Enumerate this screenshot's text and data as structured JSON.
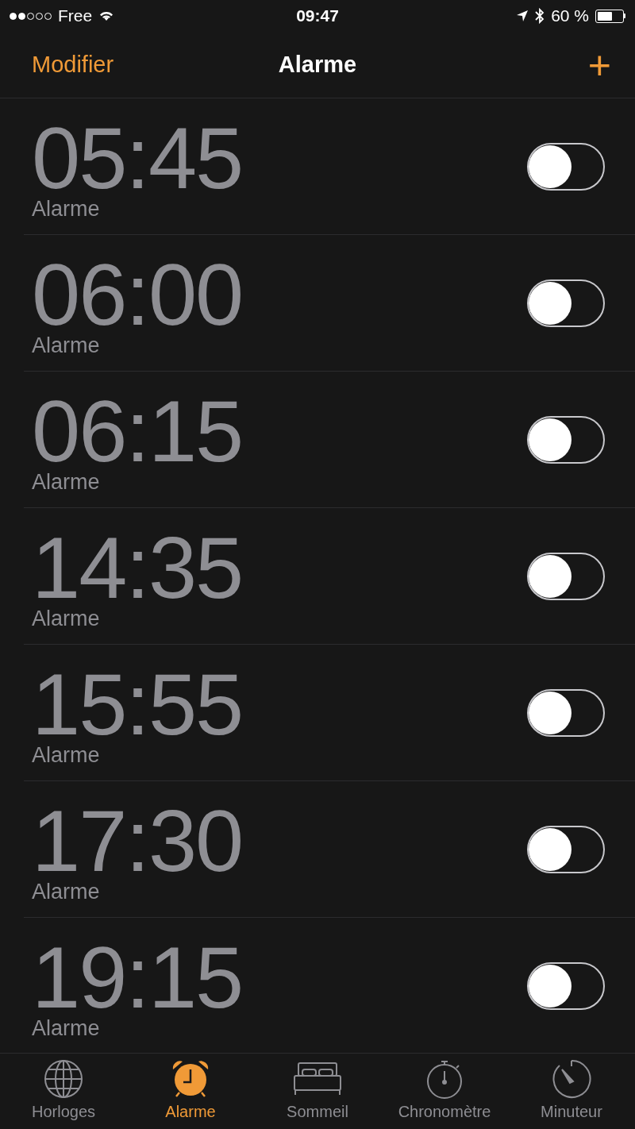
{
  "status_bar": {
    "carrier": "Free",
    "signal_dots": [
      {
        "on": true
      },
      {
        "on": true
      },
      {
        "on": false
      },
      {
        "on": false
      },
      {
        "on": false
      }
    ],
    "time": "09:47",
    "battery": "60 %"
  },
  "nav": {
    "edit": "Modifier",
    "title": "Alarme",
    "add": "+"
  },
  "alarms": [
    {
      "time": "05:45",
      "label": "Alarme",
      "on": false
    },
    {
      "time": "06:00",
      "label": "Alarme",
      "on": false
    },
    {
      "time": "06:15",
      "label": "Alarme",
      "on": false
    },
    {
      "time": "14:35",
      "label": "Alarme",
      "on": false
    },
    {
      "time": "15:55",
      "label": "Alarme",
      "on": false
    },
    {
      "time": "17:30",
      "label": "Alarme",
      "on": false
    },
    {
      "time": "19:15",
      "label": "Alarme",
      "on": false
    }
  ],
  "tabs": [
    {
      "label": "Horloges",
      "kind": "globe",
      "selected": false
    },
    {
      "label": "Alarme",
      "kind": "alarm",
      "selected": true
    },
    {
      "label": "Sommeil",
      "kind": "bed",
      "selected": false
    },
    {
      "label": "Chronomètre",
      "kind": "stopwatch",
      "selected": false
    },
    {
      "label": "Minuteur",
      "kind": "timer",
      "selected": false
    }
  ]
}
